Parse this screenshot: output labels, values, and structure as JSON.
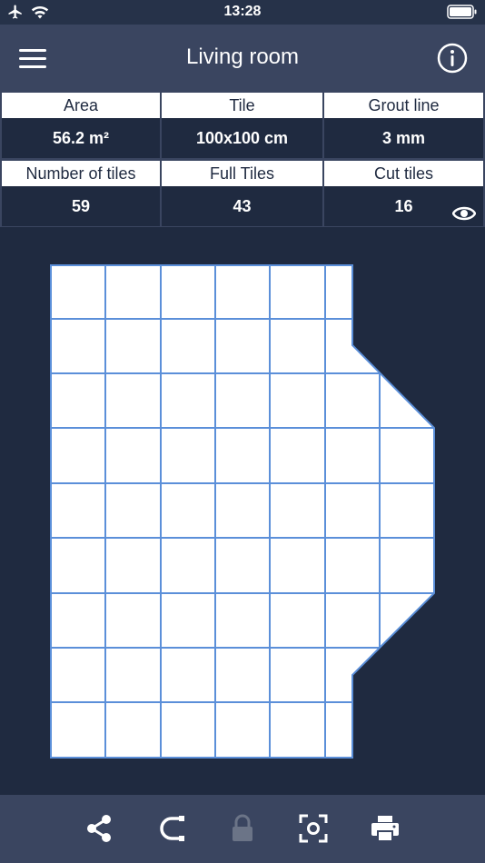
{
  "status_bar": {
    "time": "13:28"
  },
  "nav": {
    "title": "Living room"
  },
  "stats": {
    "area": {
      "label": "Area",
      "value": "56.2 m²"
    },
    "tile": {
      "label": "Tile",
      "value": "100x100 cm"
    },
    "grout": {
      "label": "Grout line",
      "value": "3 mm"
    },
    "number_of_tiles": {
      "label": "Number of tiles",
      "value": "59"
    },
    "full_tiles": {
      "label": "Full Tiles",
      "value": "43"
    },
    "cut_tiles": {
      "label": "Cut tiles",
      "value": "16"
    }
  },
  "colors": {
    "background": "#1f2a40",
    "bar": "#3a4560",
    "tile_fill": "#ffffff",
    "grout_line": "#5b8fd9"
  },
  "icons": {
    "status": [
      "airplane-icon",
      "wifi-icon",
      "battery-icon"
    ],
    "nav": [
      "menu-icon",
      "info-icon"
    ],
    "stats": [
      "eye-icon"
    ],
    "toolbar": [
      "share-icon",
      "magnet-icon",
      "lock-icon",
      "screenshot-icon",
      "print-icon"
    ]
  }
}
